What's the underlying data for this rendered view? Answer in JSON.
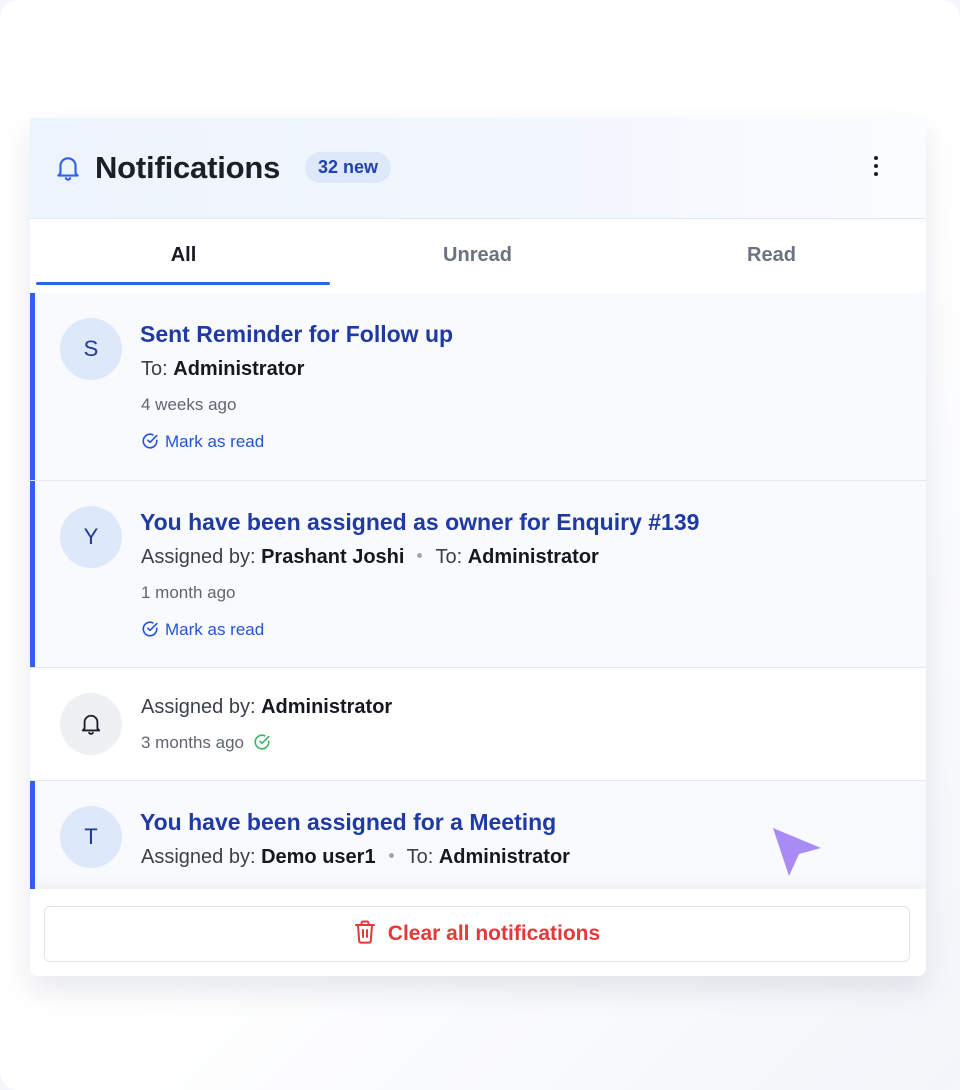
{
  "header": {
    "title": "Notifications",
    "badge": "32 new"
  },
  "tabs": [
    {
      "label": "All",
      "active": true
    },
    {
      "label": "Unread",
      "active": false
    },
    {
      "label": "Read",
      "active": false
    }
  ],
  "notifications": [
    {
      "avatar": "S",
      "title": "Sent Reminder for Follow up",
      "to_label": "To:",
      "to": "Administrator",
      "time": "4 weeks ago",
      "action": "Mark as read",
      "unread": true
    },
    {
      "avatar": "Y",
      "title": "You have been assigned as owner for Enquiry #139",
      "assigned_label": "Assigned by:",
      "assigned_by": "Prashant Joshi",
      "to_label": "To:",
      "to": "Administrator",
      "time": "1 month ago",
      "action": "Mark as read",
      "unread": true
    },
    {
      "avatar_icon": "bell-icon",
      "assigned_label": "Assigned by:",
      "assigned_by": "Administrator",
      "time": "3 months ago",
      "status_icon": "check-circle-icon",
      "unread": false
    },
    {
      "avatar": "T",
      "title": "You have been assigned for a Meeting",
      "assigned_label": "Assigned by:",
      "assigned_by": "Demo user1",
      "to_label": "To:",
      "to": "Administrator",
      "unread": true
    }
  ],
  "footer": {
    "clear_label": "Clear all notifications",
    "icon": "trash-icon"
  },
  "colors": {
    "accent": "#2f62e8",
    "title_blue": "#1f3aa3",
    "danger": "#e23a3a",
    "success": "#3cb55e",
    "cursor": "#a98bf5"
  }
}
